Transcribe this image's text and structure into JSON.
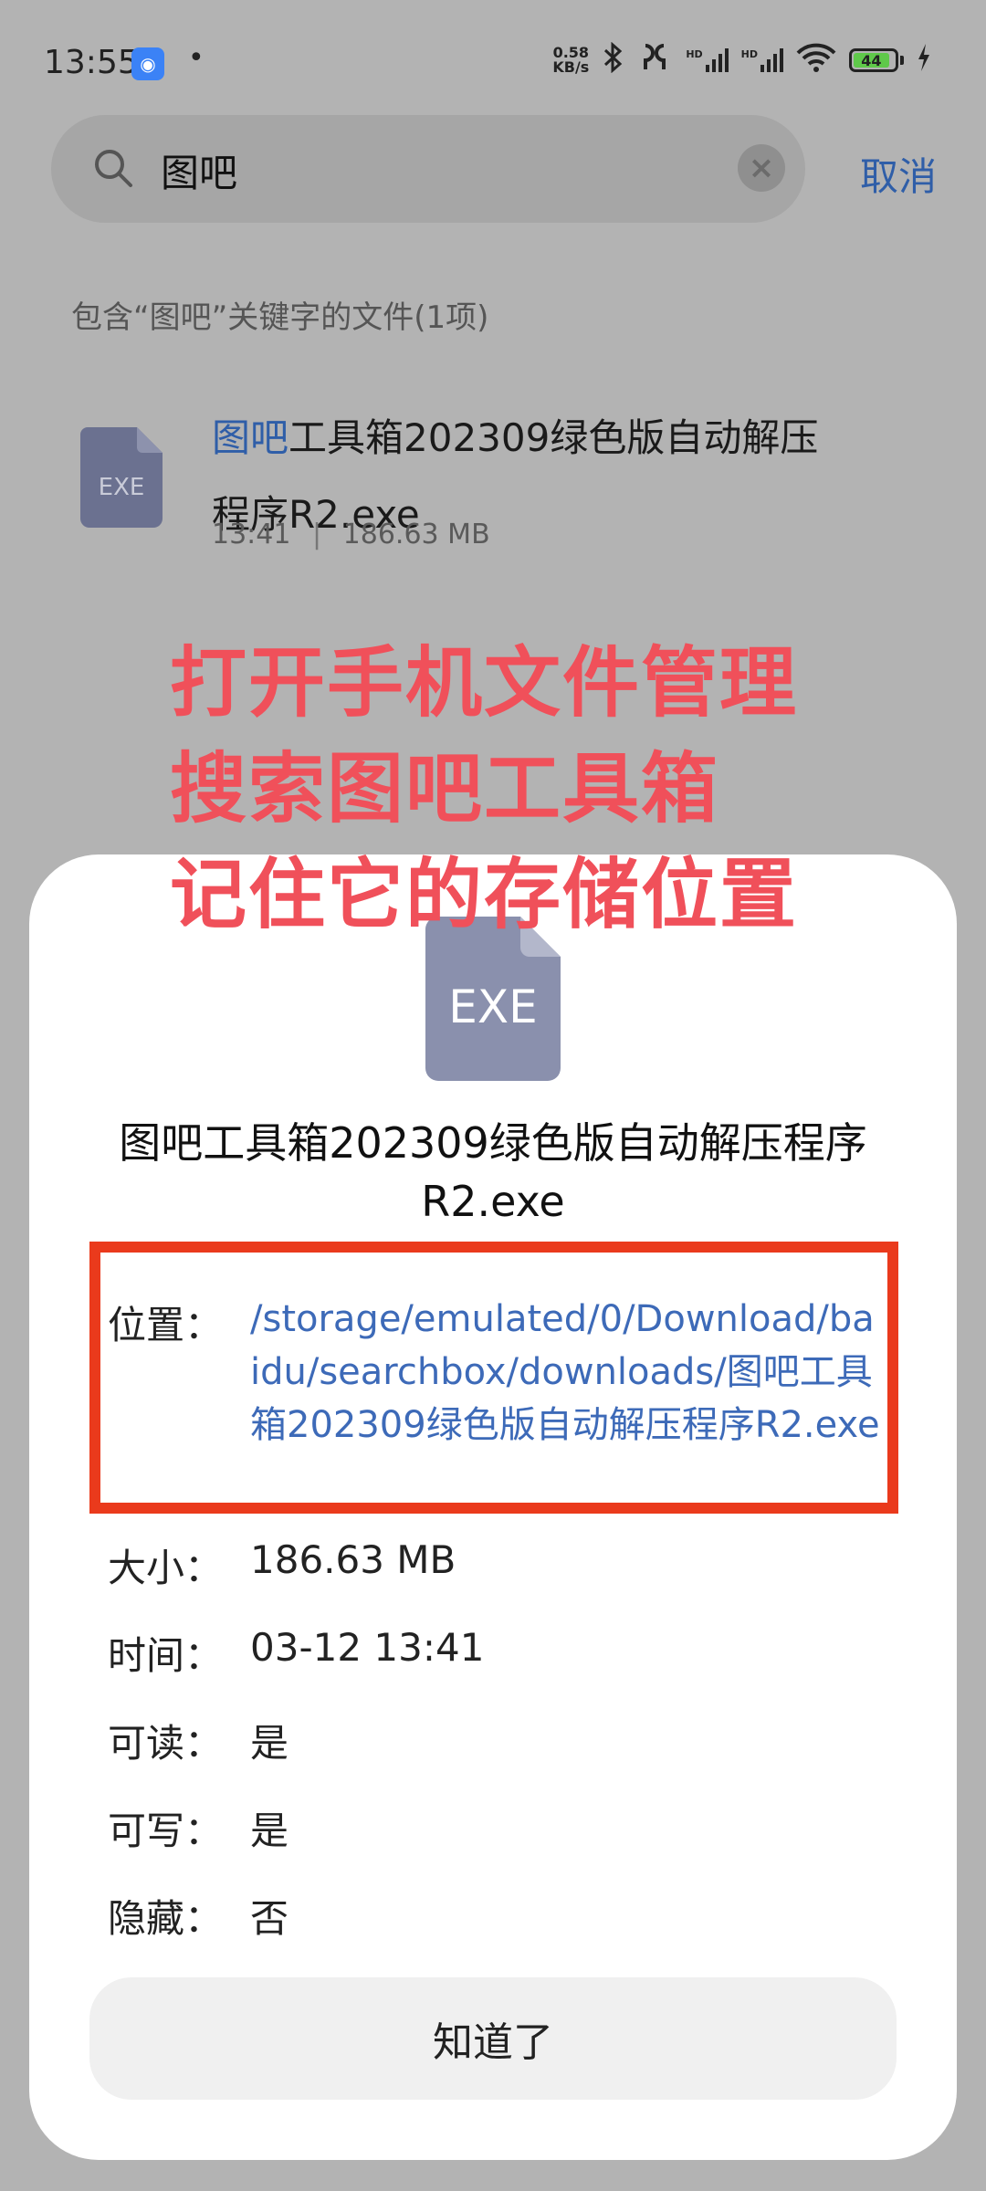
{
  "status_bar": {
    "time": "13:55",
    "dot": "•",
    "net_speed_value": "0.58",
    "net_speed_unit": "KB/s",
    "battery": "44",
    "signal1": "HD",
    "signal2": "HD"
  },
  "search": {
    "query": "图吧",
    "cancel_label": "取消"
  },
  "results": {
    "header": "包含“图吧”关键字的文件(1项)",
    "items": [
      {
        "icon_label": "EXE",
        "title_highlight": "图吧",
        "title_rest": "工具箱202309绿色版自动解压程序R2.exe",
        "time": "13:41",
        "size": "186.63 MB"
      }
    ]
  },
  "annotation": {
    "line1": "打开手机文件管理",
    "line2": "搜索图吧工具箱",
    "line3": "记住它的存储位置"
  },
  "dialog": {
    "icon_label": "EXE",
    "title": "图吧工具箱202309绿色版自动解压程序R2.exe",
    "location_label": "位置：",
    "location_value": "/storage/emulated/0/Download/baidu/searchbox/downloads/图吧工具箱202309绿色版自动解压程序R2.exe",
    "size_label": "大小：",
    "size_value": "186.63 MB",
    "time_label": "时间：",
    "time_value": "03-12 13:41",
    "readable_label": "可读：",
    "readable_value": "是",
    "writable_label": "可写：",
    "writable_value": "是",
    "hidden_label": "隐藏：",
    "hidden_value": "否",
    "ok_label": "知道了"
  },
  "colors": {
    "accent_blue": "#2f5ea8",
    "annotation_red": "#f0505a",
    "highlight_box": "#ea3a1c",
    "battery_green": "#5fc94a"
  }
}
